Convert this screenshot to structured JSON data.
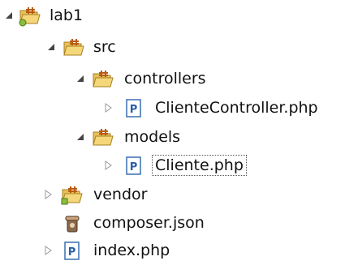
{
  "tree": [
    {
      "label": "lab1",
      "icon": "php-project-folder-icon",
      "expanded": true
    },
    {
      "label": "src",
      "icon": "source-folder-icon",
      "expanded": true
    },
    {
      "label": "controllers",
      "icon": "source-folder-icon",
      "expanded": true
    },
    {
      "label": "ClienteController.php",
      "icon": "php-file-icon",
      "expanded": false
    },
    {
      "label": "models",
      "icon": "source-folder-icon",
      "expanded": true
    },
    {
      "label": "Cliente.php",
      "icon": "php-file-icon",
      "expanded": false,
      "selected": true
    },
    {
      "label": "vendor",
      "icon": "php-library-folder-icon",
      "expanded": false
    },
    {
      "label": "composer.json",
      "icon": "composer-icon"
    },
    {
      "label": "index.php",
      "icon": "php-file-icon",
      "expanded": false
    }
  ],
  "colors": {
    "folder": "#e8c15e",
    "file_border": "#3a6fb0",
    "file_letter": "#2a5fa8"
  }
}
